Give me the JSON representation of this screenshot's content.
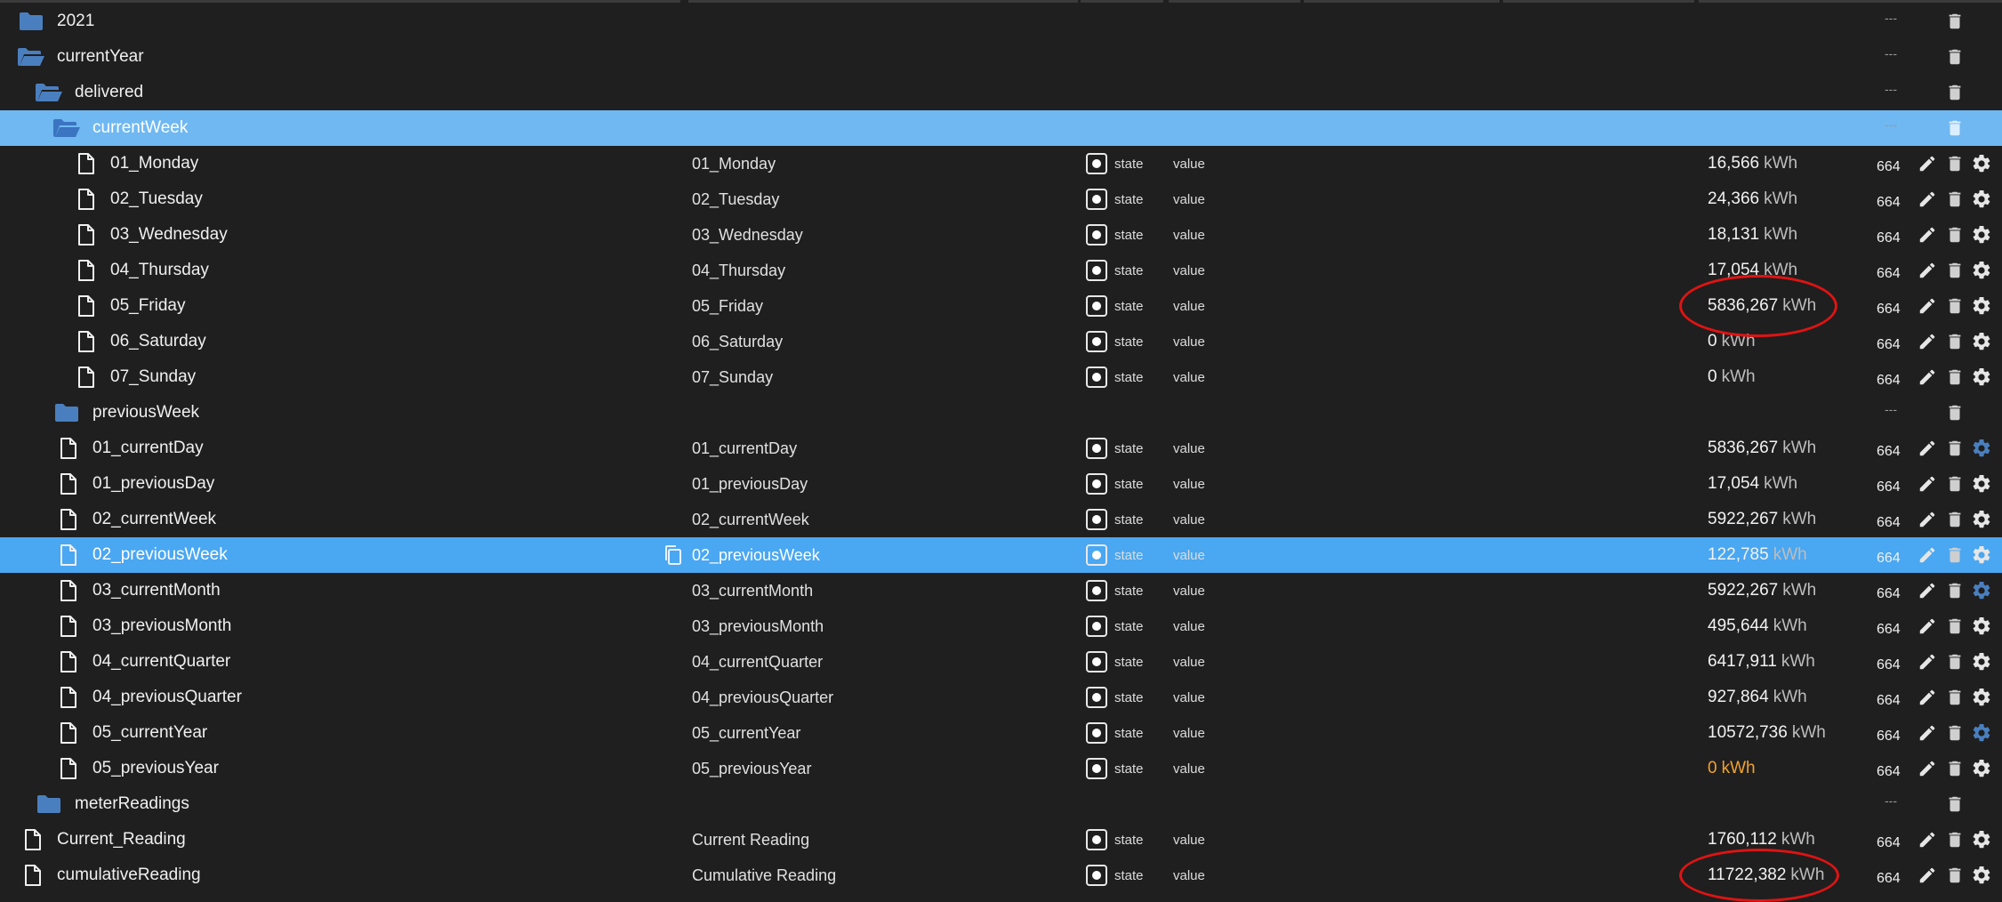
{
  "colors": {
    "background": "#1f1f1f",
    "selected_row": "#4aa7f2",
    "selected_folder_row": "#6fb8f2",
    "folder_icon": "#4a7fbf",
    "value_warning": "#f0a22e",
    "highlight_circle": "#e01313"
  },
  "rows": [
    {
      "kind": "folder",
      "name": "2021",
      "open": false,
      "indent": 0
    },
    {
      "kind": "folder",
      "name": "currentYear",
      "open": true,
      "indent": 0
    },
    {
      "kind": "folder",
      "name": "delivered",
      "open": true,
      "indent": 1
    },
    {
      "kind": "folder",
      "name": "currentWeek",
      "open": true,
      "indent": 2,
      "selected": true
    },
    {
      "kind": "state",
      "name": "01_Monday",
      "label": "01_Monday",
      "role": "state",
      "type": "value",
      "value": "16,566",
      "unit": "kWh",
      "count": "664",
      "indent": 3
    },
    {
      "kind": "state",
      "name": "02_Tuesday",
      "label": "02_Tuesday",
      "role": "state",
      "type": "value",
      "value": "24,366",
      "unit": "kWh",
      "count": "664",
      "indent": 3
    },
    {
      "kind": "state",
      "name": "03_Wednesday",
      "label": "03_Wednesday",
      "role": "state",
      "type": "value",
      "value": "18,131",
      "unit": "kWh",
      "count": "664",
      "indent": 3
    },
    {
      "kind": "state",
      "name": "04_Thursday",
      "label": "04_Thursday",
      "role": "state",
      "type": "value",
      "value": "17,054",
      "unit": "kWh",
      "count": "664",
      "indent": 3
    },
    {
      "kind": "state",
      "name": "05_Friday",
      "label": "05_Friday",
      "role": "state",
      "type": "value",
      "value": "5836,267",
      "unit": "kWh",
      "count": "664",
      "indent": 3
    },
    {
      "kind": "state",
      "name": "06_Saturday",
      "label": "06_Saturday",
      "role": "state",
      "type": "value",
      "value": "0",
      "unit": "kWh",
      "count": "664",
      "indent": 3
    },
    {
      "kind": "state",
      "name": "07_Sunday",
      "label": "07_Sunday",
      "role": "state",
      "type": "value",
      "value": "0",
      "unit": "kWh",
      "count": "664",
      "indent": 3
    },
    {
      "kind": "folder",
      "name": "previousWeek",
      "open": false,
      "indent": 2
    },
    {
      "kind": "state",
      "name": "01_currentDay",
      "label": "01_currentDay",
      "role": "state",
      "type": "value",
      "value": "5836,267",
      "unit": "kWh",
      "count": "664",
      "indent": 2,
      "gear_blue": true
    },
    {
      "kind": "state",
      "name": "01_previousDay",
      "label": "01_previousDay",
      "role": "state",
      "type": "value",
      "value": "17,054",
      "unit": "kWh",
      "count": "664",
      "indent": 2
    },
    {
      "kind": "state",
      "name": "02_currentWeek",
      "label": "02_currentWeek",
      "role": "state",
      "type": "value",
      "value": "5922,267",
      "unit": "kWh",
      "count": "664",
      "indent": 2
    },
    {
      "kind": "state",
      "name": "02_previousWeek",
      "label": "02_previousWeek",
      "role": "state",
      "type": "value",
      "value": "122,785",
      "unit": "kWh",
      "count": "664",
      "indent": 2,
      "selected": true,
      "copy": true
    },
    {
      "kind": "state",
      "name": "03_currentMonth",
      "label": "03_currentMonth",
      "role": "state",
      "type": "value",
      "value": "5922,267",
      "unit": "kWh",
      "count": "664",
      "indent": 2,
      "gear_blue": true
    },
    {
      "kind": "state",
      "name": "03_previousMonth",
      "label": "03_previousMonth",
      "role": "state",
      "type": "value",
      "value": "495,644",
      "unit": "kWh",
      "count": "664",
      "indent": 2
    },
    {
      "kind": "state",
      "name": "04_currentQuarter",
      "label": "04_currentQuarter",
      "role": "state",
      "type": "value",
      "value": "6417,911",
      "unit": "kWh",
      "count": "664",
      "indent": 2
    },
    {
      "kind": "state",
      "name": "04_previousQuarter",
      "label": "04_previousQuarter",
      "role": "state",
      "type": "value",
      "value": "927,864",
      "unit": "kWh",
      "count": "664",
      "indent": 2
    },
    {
      "kind": "state",
      "name": "05_currentYear",
      "label": "05_currentYear",
      "role": "state",
      "type": "value",
      "value": "10572,736",
      "unit": "kWh",
      "count": "664",
      "indent": 2,
      "gear_blue": true
    },
    {
      "kind": "state",
      "name": "05_previousYear",
      "label": "05_previousYear",
      "role": "state",
      "type": "value",
      "value": "0",
      "unit": "kWh",
      "count": "664",
      "indent": 2,
      "value_warning": true
    },
    {
      "kind": "folder",
      "name": "meterReadings",
      "open": false,
      "indent": 1
    },
    {
      "kind": "state",
      "name": "Current_Reading",
      "label": "Current Reading",
      "role": "state",
      "type": "value",
      "value": "1760,112",
      "unit": "kWh",
      "count": "664",
      "indent": 0
    },
    {
      "kind": "state",
      "name": "cumulativeReading",
      "label": "Cumulative Reading",
      "role": "state",
      "type": "value",
      "value": "11722,382",
      "unit": "kWh",
      "count": "664",
      "indent": 0
    }
  ],
  "annotations": [
    {
      "shape": "red-circle",
      "around": "05_Friday.value"
    },
    {
      "shape": "red-circle",
      "around": "cumulativeReading.value"
    }
  ],
  "icons": {
    "folder_closed": "folder-icon",
    "folder_open": "folder-open-icon",
    "state": "file-icon",
    "copy": "copy-icon",
    "edit": "pencil-icon",
    "delete": "trash-icon",
    "settings": "gear-icon",
    "role": "state-role-icon"
  }
}
